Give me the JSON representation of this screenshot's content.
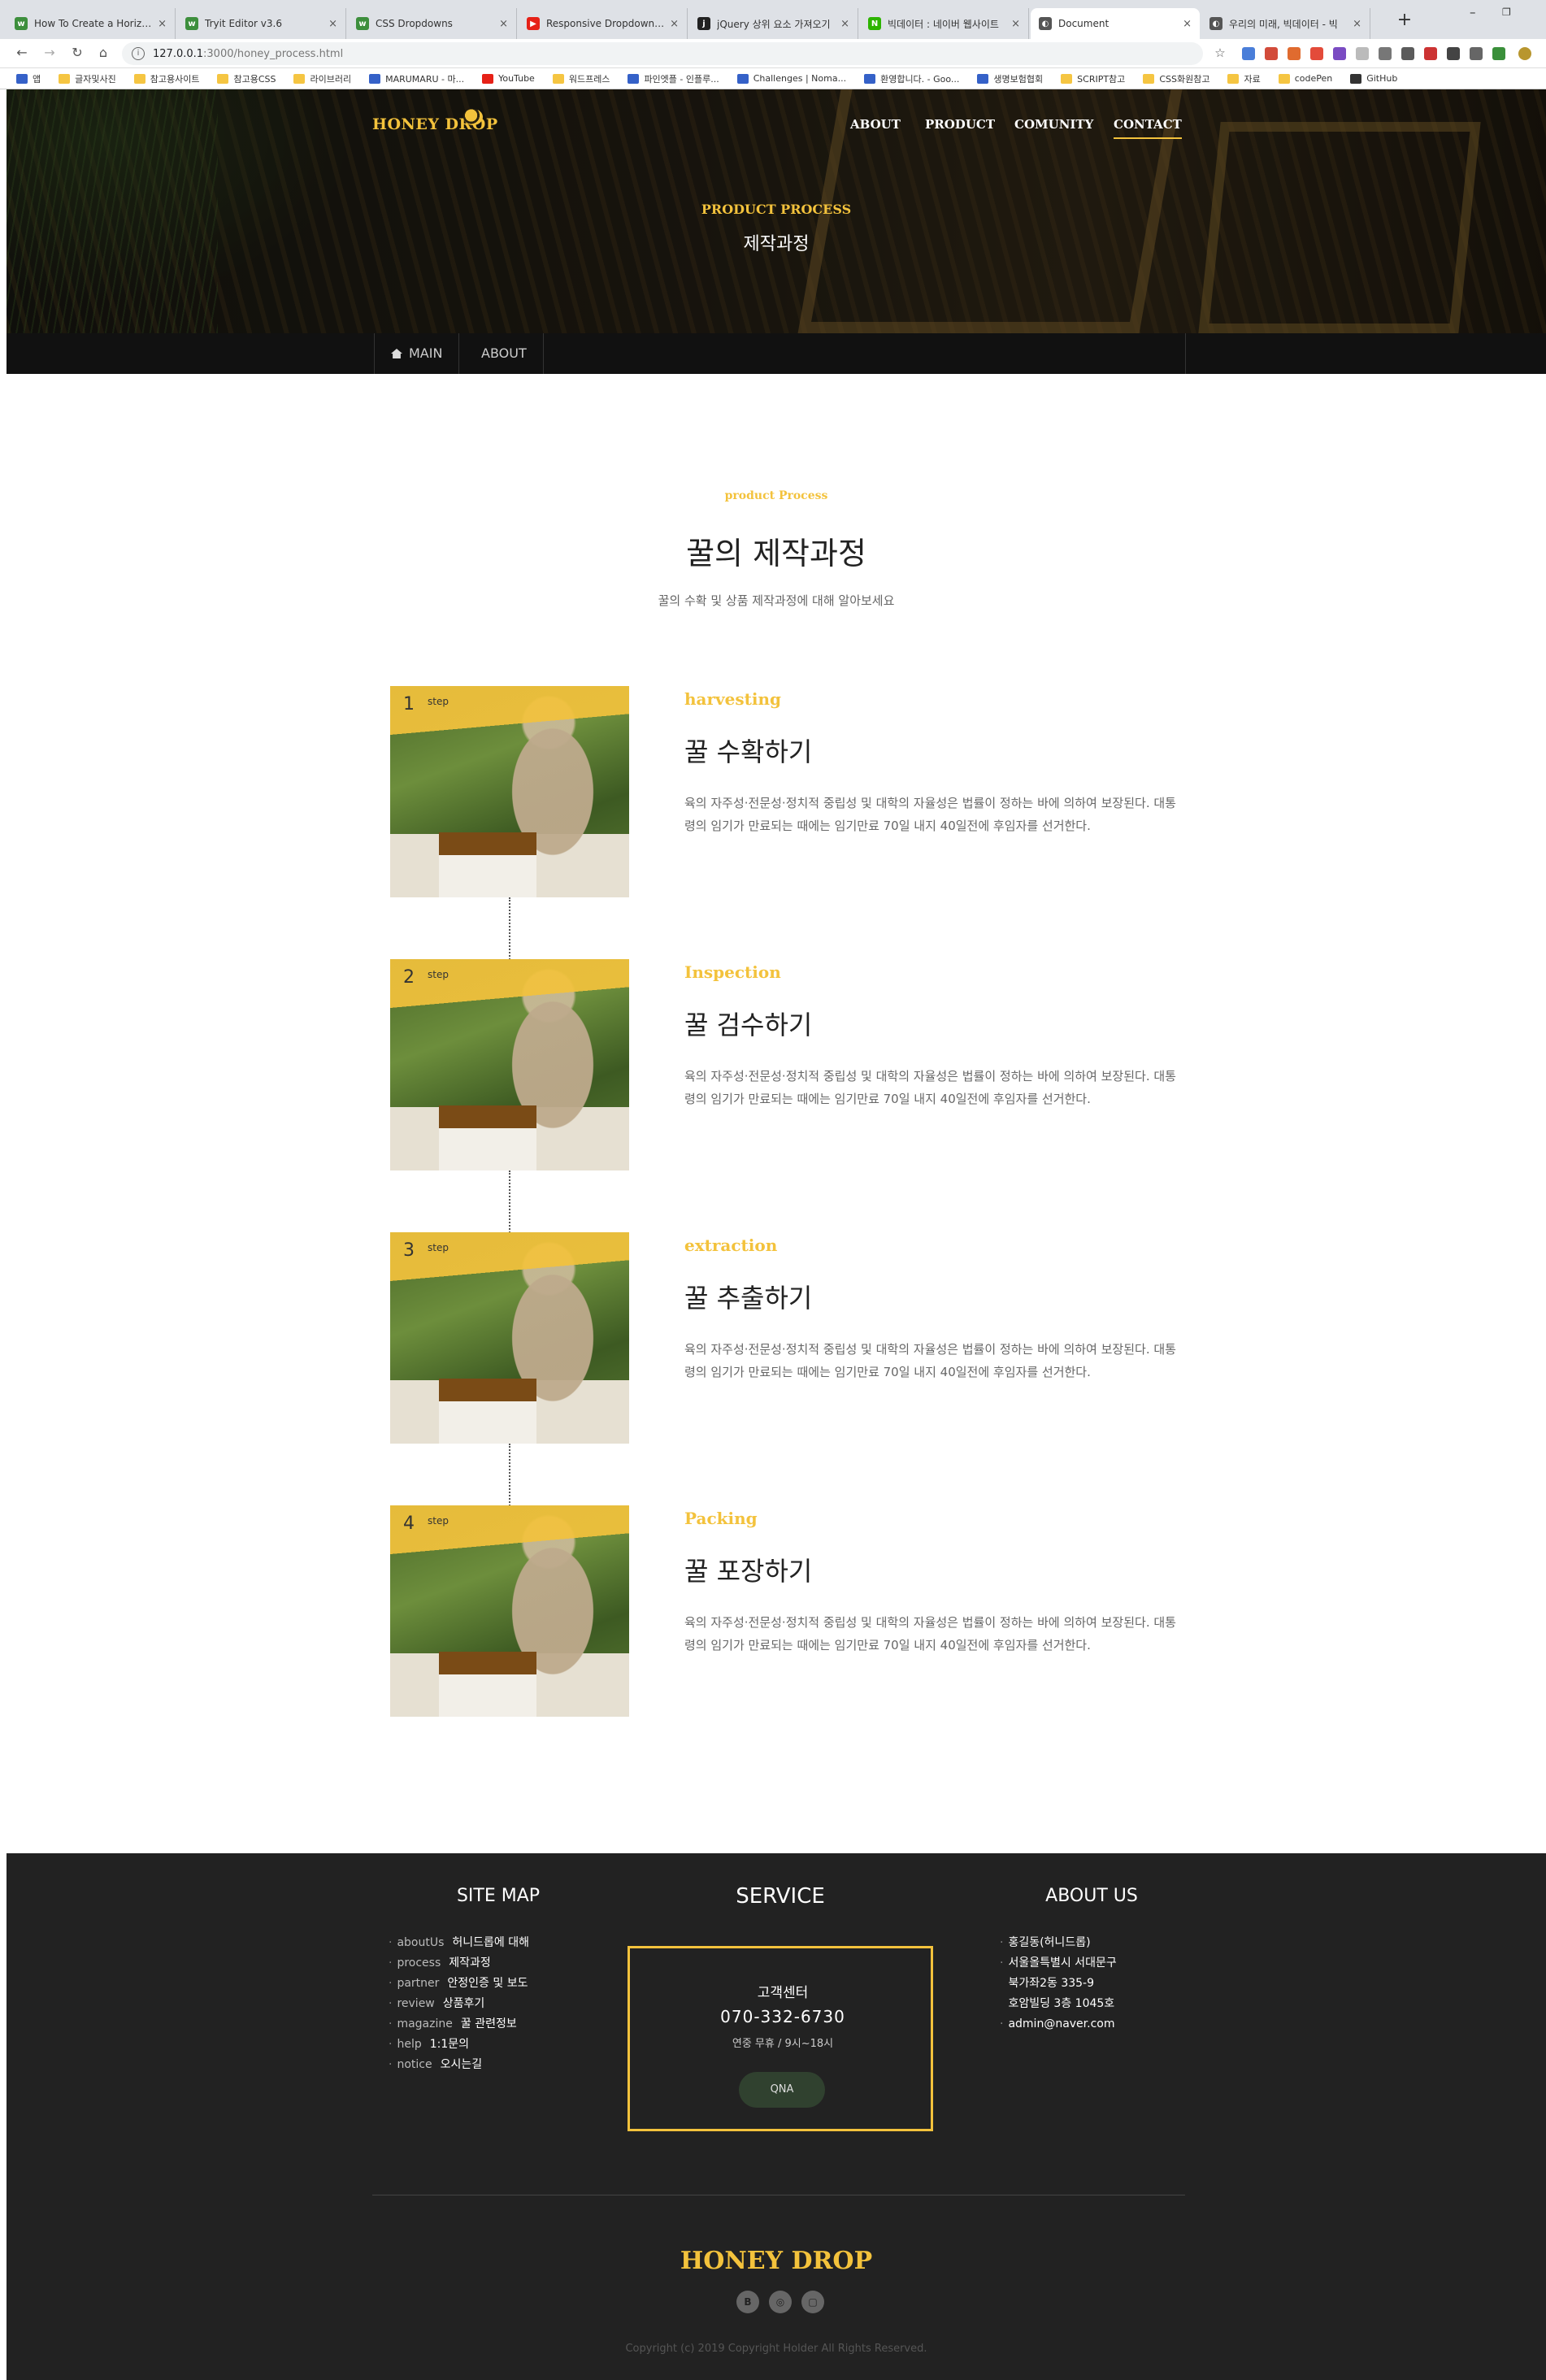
{
  "browser": {
    "tabs": [
      {
        "title": "How To Create a Horizontal",
        "color": "#3d8f3d",
        "glyph": "w"
      },
      {
        "title": "Tryit Editor v3.6",
        "color": "#3d8f3d",
        "glyph": "w"
      },
      {
        "title": "CSS Dropdowns",
        "color": "#3d8f3d",
        "glyph": "w"
      },
      {
        "title": "Responsive Dropdown Na",
        "color": "#e62117",
        "glyph": "▶"
      },
      {
        "title": "jQuery 상위 요소 가져오기",
        "color": "#222222",
        "glyph": "j"
      },
      {
        "title": "빅데이터 : 네이버 웹사이트",
        "color": "#2db400",
        "glyph": "N"
      },
      {
        "title": "Document",
        "color": "#555555",
        "glyph": "◐"
      },
      {
        "title": "우리의 미래, 빅데이터 - 빅",
        "color": "#555555",
        "glyph": "◐"
      }
    ],
    "url_host": "127.0.0.1",
    "url_path": ":3000/honey_process.html",
    "bookmarks": [
      {
        "label": "앱",
        "icon": "apps-icon"
      },
      {
        "label": "글자및사진",
        "icon": "folder-icon"
      },
      {
        "label": "참고용사이트",
        "icon": "folder-icon"
      },
      {
        "label": "참고용CSS",
        "icon": "folder-icon"
      },
      {
        "label": "라이브러리",
        "icon": "folder-icon"
      },
      {
        "label": "MARUMARU - 마...",
        "icon": "site-icon"
      },
      {
        "label": "YouTube",
        "icon": "youtube-icon"
      },
      {
        "label": "워드프레스",
        "icon": "folder-icon"
      },
      {
        "label": "파인엣플 - 인플루...",
        "icon": "site-icon"
      },
      {
        "label": "Challenges | Noma...",
        "icon": "site-icon"
      },
      {
        "label": "환영합니다. - Goo...",
        "icon": "site-icon"
      },
      {
        "label": "생명보험협회",
        "icon": "site-icon"
      },
      {
        "label": "SCRIPT참고",
        "icon": "folder-icon"
      },
      {
        "label": "CSS화원참고",
        "icon": "folder-icon"
      },
      {
        "label": "자료",
        "icon": "folder-icon"
      },
      {
        "label": "codePen",
        "icon": "folder-icon"
      },
      {
        "label": "GitHub",
        "icon": "github-icon"
      }
    ]
  },
  "header": {
    "logo": "HONEY DROP",
    "nav": [
      "ABOUT",
      "PRODUCT",
      "COMUNITY",
      "CONTACT"
    ],
    "active_nav": "CONTACT",
    "hero_sub": "PRODUCT PROCESS",
    "hero_title": "제작과정",
    "lnb": [
      "MAIN",
      "ABOUT"
    ]
  },
  "section": {
    "sub": "product Process",
    "title": "꿀의 제작과정",
    "desc": "꿀의 수확 및 상품 제작과정에 대해 알아보세요"
  },
  "steps": [
    {
      "num": "1",
      "label": "step",
      "sub": "harvesting",
      "title": "꿀 수확하기",
      "desc": "육의 자주성·전문성·정치적 중립성 및 대학의 자율성은 법률이 정하는 바에 의하여 보장된다. 대통령의 임기가 만료되는 때에는 임기만료 70일 내지 40일전에 후임자를 선거한다."
    },
    {
      "num": "2",
      "label": "step",
      "sub": "Inspection",
      "title": "꿀 검수하기",
      "desc": "육의 자주성·전문성·정치적 중립성 및 대학의 자율성은 법률이 정하는 바에 의하여 보장된다. 대통령의 임기가 만료되는 때에는 임기만료 70일 내지 40일전에 후임자를 선거한다."
    },
    {
      "num": "3",
      "label": "step",
      "sub": "extraction",
      "title": "꿀 추출하기",
      "desc": "육의 자주성·전문성·정치적 중립성 및 대학의 자율성은 법률이 정하는 바에 의하여 보장된다. 대통령의 임기가 만료되는 때에는 임기만료 70일 내지 40일전에 후임자를 선거한다."
    },
    {
      "num": "4",
      "label": "step",
      "sub": "Packing",
      "title": "꿀 포장하기",
      "desc": "육의 자주성·전문성·정치적 중립성 및 대학의 자율성은 법률이 정하는 바에 의하여 보장된다. 대통령의 임기가 만료되는 때에는 임기만료 70일 내지 40일전에 후임자를 선거한다."
    }
  ],
  "footer": {
    "sitemap_title": "SITE MAP",
    "sitemap": [
      {
        "key": "aboutUs",
        "val": "허니드롭에 대해"
      },
      {
        "key": "process",
        "val": "제작과정"
      },
      {
        "key": "partner",
        "val": "안정인증 및 보도"
      },
      {
        "key": "review",
        "val": "상품후기"
      },
      {
        "key": "magazine",
        "val": "꿀 관련정보"
      },
      {
        "key": "help",
        "val": "1:1문의"
      },
      {
        "key": "notice",
        "val": "오시는길"
      }
    ],
    "service_title": "SERVICE",
    "service_center": "고객센터",
    "service_phone": "070-332-6730",
    "service_hours": "연중 무휴 / 9시~18시",
    "qna": "QNA",
    "about_title": "ABOUT US",
    "about": [
      "홍길동(허니드롭)",
      "서울올특별시 서대문구",
      "북가좌2동 335-9",
      "호암빌딩 3층 1045호",
      "admin@naver.com"
    ],
    "logo": "HONEY DROP",
    "sns": [
      "B",
      "◎",
      "▢"
    ],
    "copyright": "Copyright (c) 2019 Copyright Holder All Rights Reserved."
  }
}
